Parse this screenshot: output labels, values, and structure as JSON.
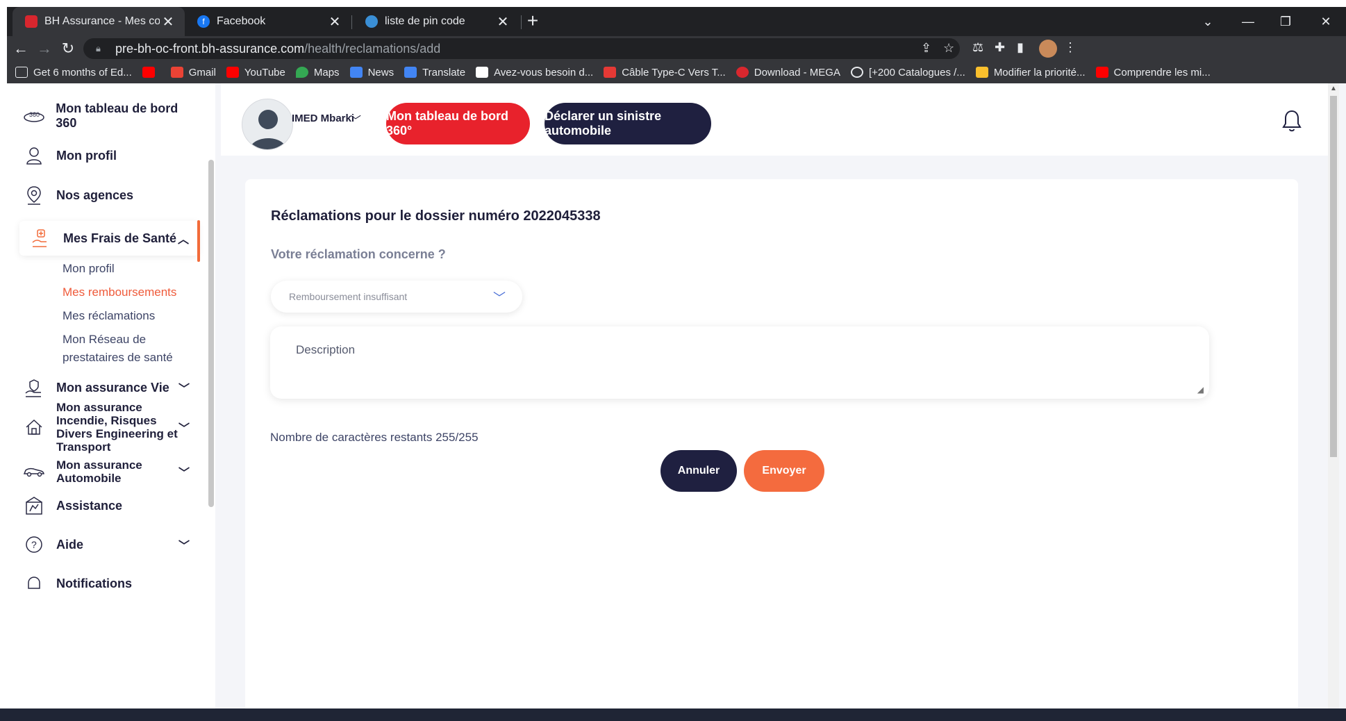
{
  "browser": {
    "tabs": [
      {
        "title": "BH Assurance - Mes contrats",
        "active": true
      },
      {
        "title": "Facebook",
        "active": false
      },
      {
        "title": "liste de pin code",
        "active": false
      }
    ],
    "url_host": "pre-bh-oc-front.bh-assurance.com",
    "url_path": "/health/reclamations/add",
    "bookmarks": [
      "Get 6 months of Ed...",
      "",
      "Gmail",
      "YouTube",
      "Maps",
      "News",
      "Translate",
      "Avez-vous besoin d...",
      "Câble Type-C Vers T...",
      "Download - MEGA",
      "[+200 Catalogues /...",
      "Modifier la priorité...",
      "Comprendre les mi..."
    ]
  },
  "sidebar": {
    "items": [
      {
        "label": "Mon tableau de bord 360",
        "icon": "dashboard-360-icon"
      },
      {
        "label": "Mon profil",
        "icon": "user-icon"
      },
      {
        "label": "Nos agences",
        "icon": "location-pin-icon"
      },
      {
        "label": "Mes Frais de Santé",
        "icon": "health-hand-icon",
        "active": true
      },
      {
        "label": "Mon assurance Vie",
        "icon": "life-insurance-icon"
      },
      {
        "label": "Mon assurance Incendie, Risques Divers Engineering et Transport",
        "icon": "home-icon"
      },
      {
        "label": "Mon assurance Automobile",
        "icon": "car-icon"
      },
      {
        "label": "Assistance",
        "icon": "assistance-icon"
      },
      {
        "label": "Aide",
        "icon": "help-icon"
      },
      {
        "label": "Notifications",
        "icon": "bell-icon"
      }
    ],
    "subitems": [
      {
        "label": "Mon profil"
      },
      {
        "label": "Mes remboursements",
        "active": true
      },
      {
        "label": "Mes réclamations"
      },
      {
        "label": "Mon Réseau de prestataires de santé"
      }
    ]
  },
  "header": {
    "username": "IMED Mbarki",
    "btn_dashboard": "Mon tableau de bord 360°",
    "btn_claim": "Déclarer un sinistre automobile"
  },
  "form": {
    "title": "Réclamations pour le dossier numéro 2022045338",
    "question": "Votre réclamation concerne ?",
    "select_value": "Remboursement insuffisant",
    "description_placeholder": "Description",
    "counter": "Nombre de caractères restants 255/255",
    "cancel": "Annuler",
    "send": "Envoyer"
  },
  "colors": {
    "accent_red": "#e8222c",
    "navy": "#1f2040",
    "orange": "#f46b3e"
  }
}
